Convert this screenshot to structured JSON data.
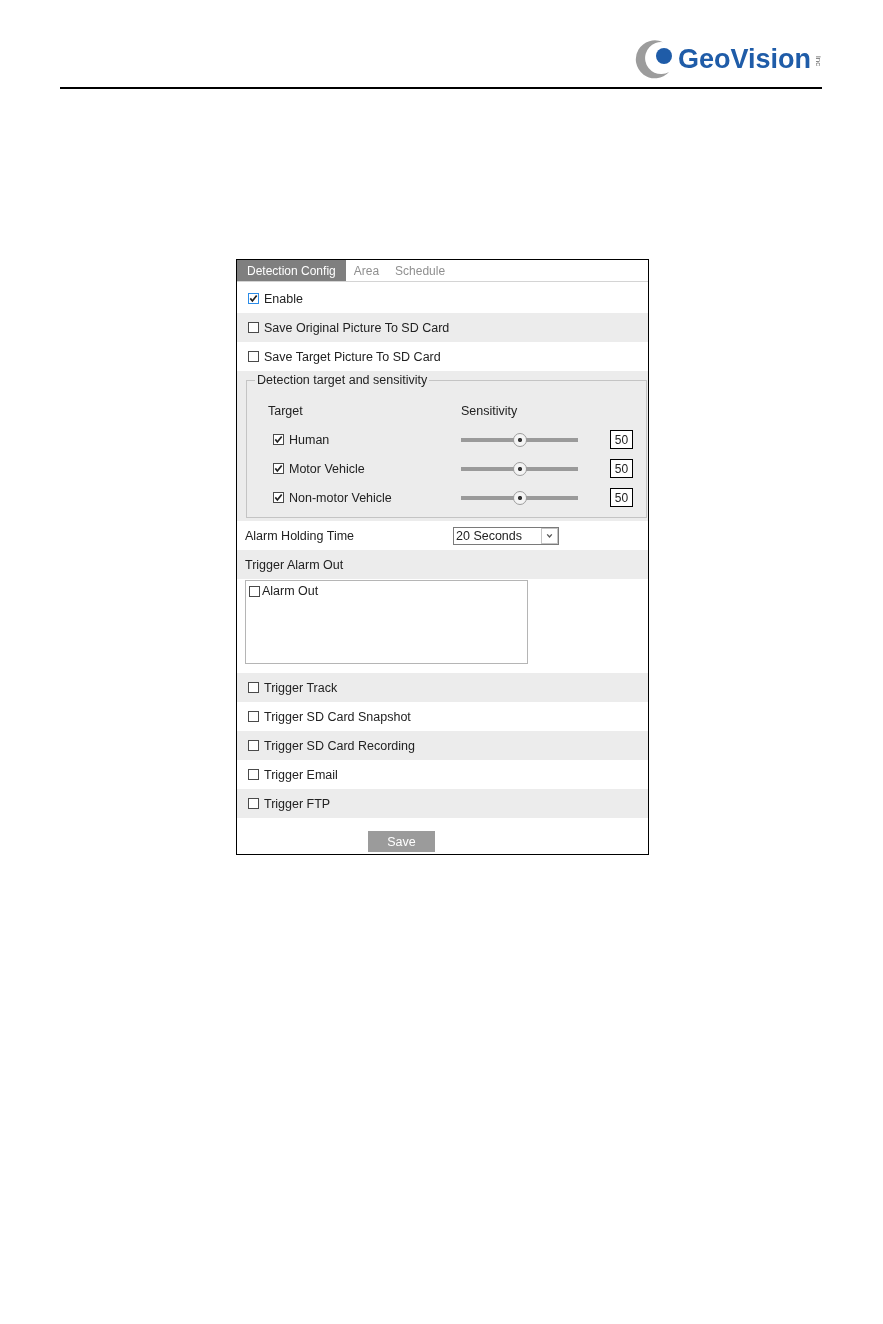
{
  "header": {
    "logo_text": "GeoVision",
    "logo_suffix": "inc"
  },
  "tabs": [
    {
      "label": "Detection Config",
      "selected": true
    },
    {
      "label": "Area",
      "selected": false
    },
    {
      "label": "Schedule",
      "selected": false
    }
  ],
  "options": [
    {
      "label": "Enable",
      "checked": true,
      "focused": true
    },
    {
      "label": "Save Original Picture To SD Card",
      "checked": false,
      "focused": false
    },
    {
      "label": "Save Target Picture To SD Card",
      "checked": false,
      "focused": false
    }
  ],
  "detection_group": {
    "legend": "Detection target and sensitivity",
    "columns": [
      "Target",
      "Sensitivity"
    ],
    "targets": [
      {
        "label": "Human",
        "checked": true,
        "level": 0.5,
        "value": "50"
      },
      {
        "label": "Motor Vehicle",
        "checked": true,
        "level": 0.5,
        "value": "50"
      },
      {
        "label": "Non-motor Vehicle",
        "checked": true,
        "level": 0.5,
        "value": "50"
      }
    ]
  },
  "alarm_holding_time": {
    "label": "Alarm Holding Time",
    "value": "20 Seconds"
  },
  "trigger_alarm_out": {
    "label": "Trigger Alarm Out",
    "items": [
      {
        "label": "Alarm Out",
        "checked": false
      }
    ]
  },
  "triggers": [
    {
      "label": "Trigger Track",
      "checked": false
    },
    {
      "label": "Trigger SD Card Snapshot",
      "checked": false
    },
    {
      "label": "Trigger SD Card Recording",
      "checked": false
    },
    {
      "label": "Trigger Email",
      "checked": false
    },
    {
      "label": "Trigger FTP",
      "checked": false
    }
  ],
  "save_button": "Save"
}
